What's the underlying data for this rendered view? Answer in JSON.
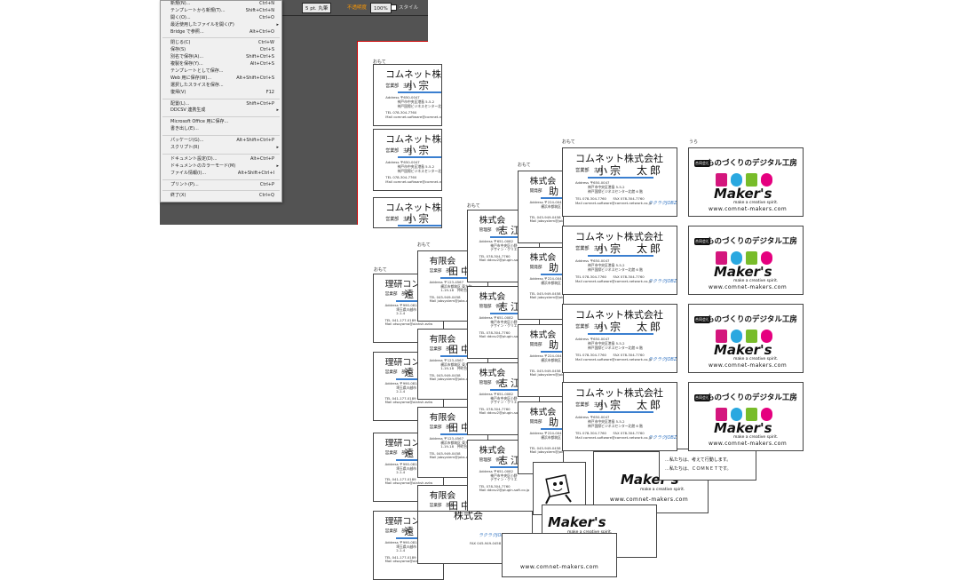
{
  "control_bar": {
    "stroke": "5 pt. 丸筆",
    "mode": "不透明度",
    "opacity": "100%",
    "style": "スタイル"
  },
  "menu": {
    "items": [
      {
        "label": "新規(N)...",
        "shortcut": "Ctrl+N"
      },
      {
        "label": "テンプレートから新規(T)...",
        "shortcut": "Shift+Ctrl+N"
      },
      {
        "label": "開く(O)...",
        "shortcut": "Ctrl+O"
      },
      {
        "label": "最近使用したファイルを開く(F)",
        "shortcut": "",
        "arrow": true
      },
      {
        "label": "Bridge で参照...",
        "shortcut": "Alt+Ctrl+O"
      },
      {
        "sep": true
      },
      {
        "label": "閉じる(C)",
        "shortcut": "Ctrl+W"
      },
      {
        "label": "保存(S)",
        "shortcut": "Ctrl+S"
      },
      {
        "label": "別名で保存(A)...",
        "shortcut": "Shift+Ctrl+S"
      },
      {
        "label": "複製を保存(Y)...",
        "shortcut": "Alt+Ctrl+S"
      },
      {
        "label": "テンプレートとして保存...",
        "shortcut": ""
      },
      {
        "label": "Web 用に保存(W)...",
        "shortcut": "Alt+Shift+Ctrl+S"
      },
      {
        "label": "選択したスライスを保存...",
        "shortcut": ""
      },
      {
        "label": "復帰(V)",
        "shortcut": "F12"
      },
      {
        "sep": true
      },
      {
        "label": "配置(L)...",
        "shortcut": "Shift+Ctrl+P"
      },
      {
        "label": "DDCSV 連携生成",
        "shortcut": "",
        "arrow": true
      },
      {
        "sep": true
      },
      {
        "label": "Microsoft Office 用に保存...",
        "shortcut": ""
      },
      {
        "label": "書き出し(E)...",
        "shortcut": ""
      },
      {
        "sep": true
      },
      {
        "label": "パッケージ(G)...",
        "shortcut": "Alt+Shift+Ctrl+P"
      },
      {
        "label": "スクリプト(R)",
        "shortcut": "",
        "arrow": true
      },
      {
        "sep": true
      },
      {
        "label": "ドキュメント設定(D)...",
        "shortcut": "Alt+Ctrl+P"
      },
      {
        "label": "ドキュメントのカラーモード(M)",
        "shortcut": "",
        "arrow": true
      },
      {
        "label": "ファイル情報(I)...",
        "shortcut": "Alt+Shift+Ctrl+I"
      },
      {
        "sep": true
      },
      {
        "label": "プリント(P)...",
        "shortcut": "Ctrl+P"
      },
      {
        "sep": true
      },
      {
        "label": "終了(X)",
        "shortcut": "Ctrl+Q"
      }
    ]
  },
  "front_label": "おもて",
  "back_label": "うら",
  "comnet": {
    "company": "コムネット株式会社",
    "dept": "営業部　主任",
    "name": "小宗　太郎",
    "addr1": "Address 〒650-0047",
    "addr2": "神戸市中央区港島 5-5-2",
    "addr3": "神戸国際ビジネスセンター北館 6 階",
    "tel": "TEL 078-304-7760　　FAX 078-304-7760",
    "mail": "Mail comnet-software@comnet-network.co.jp",
    "jobz": "ラクラクJOBZ"
  },
  "preview_comnet": {
    "company": "コムネット株",
    "dept": "営業部　主任",
    "name": "小宗　太",
    "addr1": "Address 〒650-0047",
    "addr2": "神戸市中央区港島 5-5-2",
    "addr3": "神戸国際ビジネスセンター北館",
    "tel": "TEL 078-304-7760",
    "mail": "Mail comnet-software@comnet-netwo"
  },
  "kaisha_jo": {
    "company": "株式会",
    "dept": "開発部",
    "name": "助",
    "addr1": "Address 〒224-0041",
    "addr2": "横浜市都筑区",
    "addr3": "",
    "tel": "TEL 045-949-0458",
    "mail": "Mail jobsystem@jobs.co.jp"
  },
  "kaisha_shie": {
    "company": "株式会",
    "dept": "管理部　係長",
    "name": "志江",
    "addr1": "Address 〒651-0082",
    "addr2": "神戸市中央区小野",
    "addr3": "デザイン・クリエ",
    "tel": "TEL 078-304-7760",
    "mail": "Mail ddcsv2@plugin-soft.co.jp"
  },
  "yugen": {
    "company": "有限会",
    "dept": "営業部　部長",
    "name": "田中",
    "addr1": "Address 〒123-4567",
    "addr2": "横浜市都筑区 東方町",
    "addr3": "1-19-18　仲町台ビル",
    "tel": "TEL 045-949-0458　　FAX",
    "mail": "Mail jobsystem@jobs.co.jp"
  },
  "riken": {
    "company": "理研コン",
    "dept": "営業部　部長",
    "name": "遠",
    "addr1": "Address 〒990-0818",
    "addr2": "埼玉県川越市",
    "addr3": "2-1-4",
    "tel": "TEL 041-177-0189",
    "mail": "Mail otsoyama@olahsh.ezlw"
  },
  "brand": {
    "tag": "合同会社",
    "head": "ものづくりのデジタル工房",
    "logo": "Maker's",
    "sub": "make a creative spirit.",
    "url": "www.comnet-makers.com",
    "block_colors": [
      "#d4167d",
      "#2aa8e0",
      "#78bc2a",
      "#e5007f",
      "#1a9ed9",
      "#4cb033"
    ]
  },
  "front_partial": {
    "jobz": "ラクラクJOBZ",
    "fax": "FAX 045-949-0458",
    "addr2": "神戸市中央区港島 1-4",
    "addr3": "デザイン・クリエイティブセンター神戸",
    "tel": "TEL 078-304-7760　FAX 078-304-7760",
    "mail": "Mail ddcsv2@plugin-soft.co.jp",
    "company": "株式会"
  },
  "message": {
    "line1": "…私たちは、考えて行動します。",
    "line2": "…私たちは、ＣＯＭＮＥＴです。"
  },
  "cut_text": "デジタル工房"
}
